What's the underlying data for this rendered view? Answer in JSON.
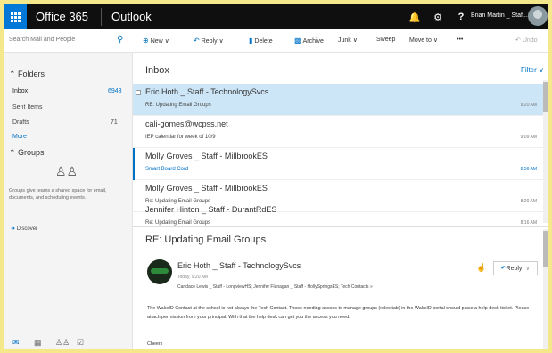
{
  "topbar": {
    "suite": "Office 365",
    "app": "Outlook",
    "user": "Brian Martin _ Staf..."
  },
  "search": {
    "placeholder": "Search Mail and People"
  },
  "commands": {
    "new": "New",
    "reply": "Reply",
    "delete": "Delete",
    "archive": "Archive",
    "junk": "Junk",
    "sweep": "Sweep",
    "move_to": "Move to",
    "more": "•••",
    "undo": "Undo"
  },
  "nav": {
    "folders_header": "Folders",
    "folders": [
      {
        "label": "Inbox",
        "count": "6943"
      },
      {
        "label": "Sent Items",
        "count": ""
      },
      {
        "label": "Drafts",
        "count": "71"
      },
      {
        "label": "More",
        "count": ""
      }
    ],
    "groups_header": "Groups",
    "groups_text": "Groups give teams a shared space for email, documents, and scheduling events.",
    "discover": "Discover"
  },
  "list": {
    "title": "Inbox",
    "filter": "Filter",
    "messages": [
      {
        "from": "Eric Hoth _ Staff - TechnologySvcs",
        "subject": "RE: Updating Email Groups",
        "time": "9:20 AM"
      },
      {
        "from": "cali-gomes@wcpss.net",
        "subject": "IEP calendar for week of 10/9",
        "time": "9:09 AM"
      },
      {
        "from": "Molly Groves _ Staff - MillbrookES",
        "subject": "Smart Board Cord",
        "time": "8:56 AM"
      },
      {
        "from": "Molly Groves _ Staff - MillbrookES",
        "subject": "Re: Updating Email Groups",
        "time": "8:20 AM"
      },
      {
        "from": "Jennifer Hinton _ Staff - DurantRdES",
        "subject": "Re: Updating Email Groups",
        "time": "8:16 AM"
      }
    ]
  },
  "reading": {
    "subject": "RE: Updating Email Groups",
    "from": "Eric Hoth _ Staff - TechnologySvcs",
    "date": "Today, 9:20 AM",
    "to": "Candace Lewis _ Staff - LongviewHS; Jennifer Flanagan _ Staff - HollySpringsES; Tech Contacts »",
    "reply": "Reply",
    "body": "The WakeID Contact at the school is not always the Tech Contact. Those needing access to manage groups (roles tab) in the WakeID portal should place a help desk ticket. Please attach permission from your principal. With that the help desk can get you the access you need.",
    "closing": "Cheers"
  }
}
